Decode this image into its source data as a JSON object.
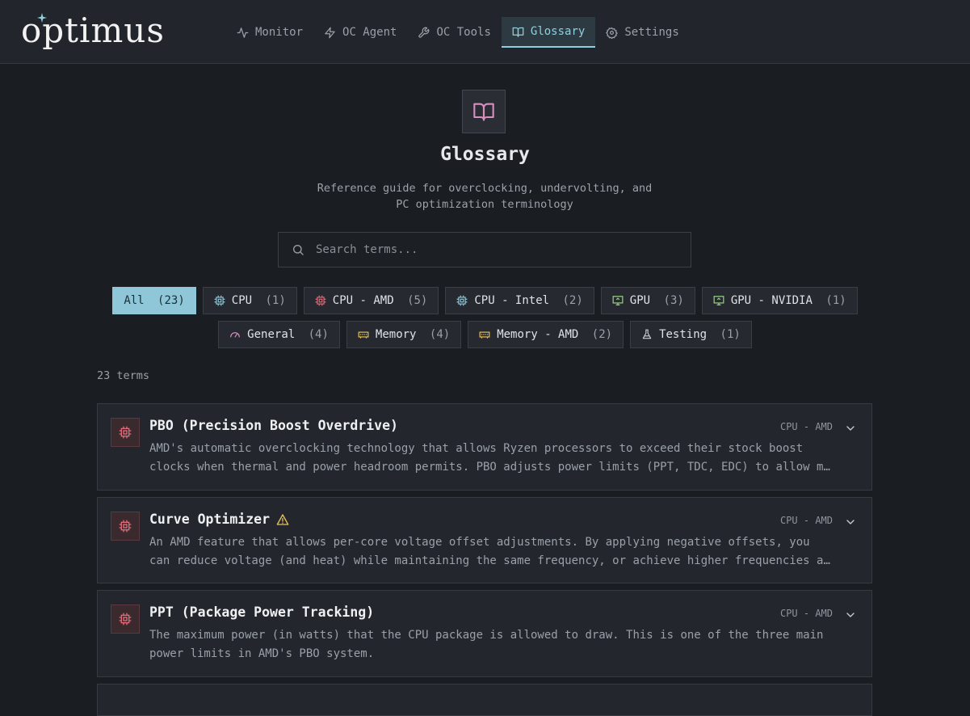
{
  "app": {
    "logo_text": "optimus"
  },
  "nav": {
    "items": [
      {
        "label": "Monitor",
        "icon": "activity-icon"
      },
      {
        "label": "OC Agent",
        "icon": "zap-icon"
      },
      {
        "label": "OC Tools",
        "icon": "wrench-icon"
      },
      {
        "label": "Glossary",
        "icon": "book-icon",
        "active": true
      },
      {
        "label": "Settings",
        "icon": "gear-icon"
      }
    ]
  },
  "hero": {
    "icon": "book-open-icon",
    "title": "Glossary",
    "subtitle_line1": "Reference guide for overclocking, undervolting, and",
    "subtitle_line2": "PC optimization terminology"
  },
  "search": {
    "placeholder": "Search terms...",
    "value": ""
  },
  "filters": {
    "row1": [
      {
        "label": "All",
        "count": "(23)",
        "active": true
      },
      {
        "label": "CPU",
        "count": "(1)",
        "icon": "cpu-icon"
      },
      {
        "label": "CPU - AMD",
        "count": "(5)",
        "icon": "cpu-icon"
      },
      {
        "label": "CPU - Intel",
        "count": "(2)",
        "icon": "cpu-icon"
      },
      {
        "label": "GPU",
        "count": "(3)",
        "icon": "monitor-icon"
      },
      {
        "label": "GPU - NVIDIA",
        "count": "(1)",
        "icon": "monitor-icon"
      }
    ],
    "row2": [
      {
        "label": "General",
        "count": "(4)",
        "icon": "gauge-icon"
      },
      {
        "label": "Memory",
        "count": "(4)",
        "icon": "memory-icon"
      },
      {
        "label": "Memory - AMD",
        "count": "(2)",
        "icon": "memory-icon"
      },
      {
        "label": "Testing",
        "count": "(1)",
        "icon": "flask-icon"
      }
    ]
  },
  "results": {
    "count_text": "23 terms"
  },
  "terms": [
    {
      "title": "PBO (Precision Boost Overdrive)",
      "tag": "CPU - AMD",
      "desc_line1": "AMD's automatic overclocking technology that allows Ryzen processors to exceed their stock boost",
      "desc_line2": "clocks when thermal and power headroom permits. PBO adjusts power limits (PPT, TDC, EDC) to allow more sustained boost."
    },
    {
      "title": "Curve Optimizer",
      "warning": true,
      "tag": "CPU - AMD",
      "desc_line1": "An AMD feature that allows per-core voltage offset adjustments. By applying negative offsets, you",
      "desc_line2": "can reduce voltage (and heat) while maintaining the same frequency, or achieve higher frequencies at the same voltage."
    },
    {
      "title": "PPT (Package Power Tracking)",
      "tag": "CPU - AMD",
      "desc_line1": "The maximum power (in watts) that the CPU package is allowed to draw. This is one of the three main",
      "desc_line2": "power limits in AMD's PBO system."
    }
  ],
  "colors": {
    "accent": "#8fc7d8",
    "background": "#1a1d22",
    "card": "#23272d",
    "cpu_amd_icon": "#e06b7a",
    "warning": "#e8c15a",
    "book_icon": "#d98ec0"
  }
}
